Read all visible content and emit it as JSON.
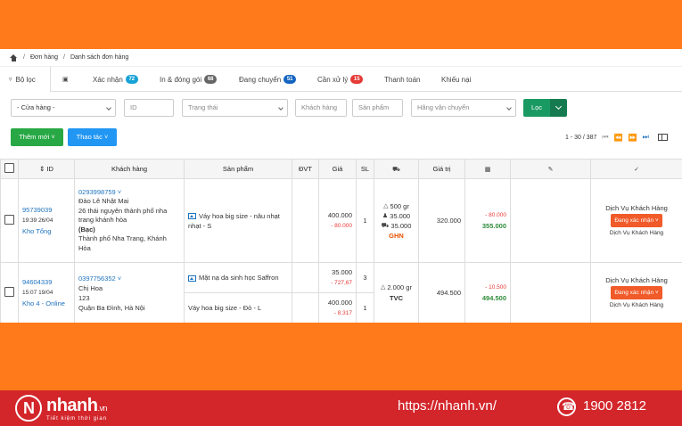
{
  "breadcrumb": [
    "Đơn hàng",
    "Danh sách đơn hàng"
  ],
  "tabs": {
    "filter": "Bộ lọc",
    "items": [
      {
        "label": "Xác nhận",
        "badge": "72"
      },
      {
        "label": "In & đóng gói",
        "badge": "68"
      },
      {
        "label": "Đang chuyển",
        "badge": "51"
      },
      {
        "label": "Cần xử lý",
        "badge": "15"
      },
      {
        "label": "Thanh toán"
      },
      {
        "label": "Khiếu nại"
      }
    ]
  },
  "filters": {
    "store": "- Cửa hàng -",
    "id": "ID",
    "status": "Trạng thái",
    "customer": "Khách hàng",
    "product": "Sản phẩm",
    "carrier": "Hãng vận chuyển",
    "apply": "Lọc"
  },
  "actions": {
    "add_new": "Thêm mới",
    "operations": "Thao tác",
    "pagination": "1 - 30 / 387"
  },
  "table": {
    "headers": {
      "id": "ID",
      "customer": "Khách hàng",
      "product": "Sản phẩm",
      "unit": "ĐVT",
      "price": "Giá",
      "qty": "SL",
      "value": "Giá trị"
    },
    "rows": [
      {
        "id": "95739039",
        "time": "19:39 26/04",
        "warehouse": "Kho Tổng",
        "phone": "0293998759",
        "name": "Đào Lê Nhật Mai",
        "address": "26 thái nguyên thành phố nha trang khánh hòa",
        "tier": "(Bạc)",
        "city": "Thành phố Nha Trang, Khánh Hòa",
        "products": [
          {
            "name": "Váy hoa big size - nâu nhạt nhạt - S",
            "price": "400.000",
            "discount": "- 80.000",
            "qty": "1"
          }
        ],
        "ship_weight": "500 gr",
        "ship_fee1": "35.000",
        "ship_fee2": "35.000",
        "carrier": "GHN",
        "value": "320.000",
        "pay_discount": "- 80.000",
        "pay_total": "355.000",
        "owner": "Dịch Vụ Khách Hàng",
        "status": "Đang xác nhận",
        "creator": "Dịch Vụ Khách Hàng"
      },
      {
        "id": "94604339",
        "time": "15:07 19/04",
        "warehouse": "Kho 4 - Online",
        "phone": "0397756352",
        "name": "Chị Hoa",
        "address": "123",
        "city": "Quận Ba Đình, Hà Nội",
        "products": [
          {
            "name": "Mặt nạ da sinh học Saffron",
            "price": "35.000",
            "discount": "- 727,67",
            "qty": "3"
          },
          {
            "name": "Váy hoa big size - Đỏ - L",
            "price": "400.000",
            "discount": "- 8.317",
            "qty": "1"
          }
        ],
        "ship_weight": "2.000 gr",
        "carrier": "TVC",
        "value": "494.500",
        "pay_discount": "- 10.500",
        "pay_total": "494.500",
        "owner": "Dịch Vụ Khách Hàng",
        "status": "Đang xác nhận",
        "creator": "Dịch Vụ Khách Hàng"
      }
    ]
  },
  "footer": {
    "brand": "nhanh",
    "brand_suffix": ".vn",
    "tagline": "Tiết kiệm thời gian",
    "url": "https://nhanh.vn/",
    "phone": "1900 2812"
  }
}
